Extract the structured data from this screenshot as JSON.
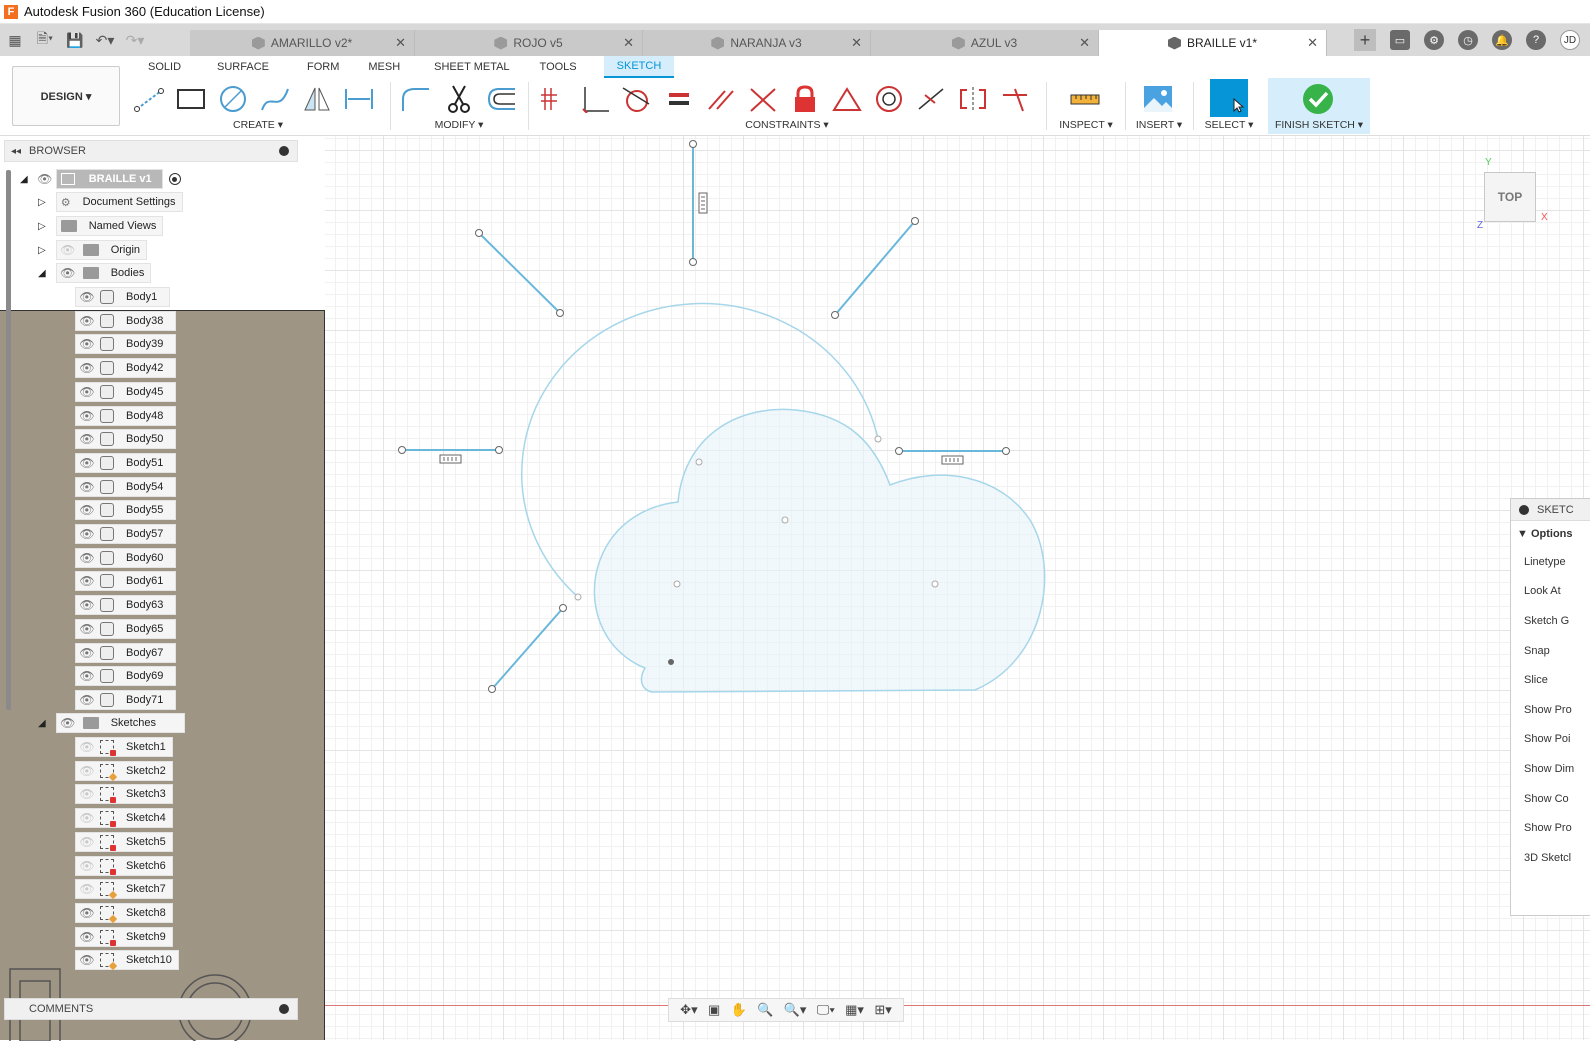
{
  "window": {
    "title": "Autodesk Fusion 360 (Education License)"
  },
  "tabs": [
    {
      "label": "AMARILLO v2*",
      "active": false
    },
    {
      "label": "ROJO v5",
      "active": false
    },
    {
      "label": "NARANJA v3",
      "active": false
    },
    {
      "label": "AZUL v3",
      "active": false
    },
    {
      "label": "BRAILLE v1*",
      "active": true
    }
  ],
  "user": {
    "initials": "JD"
  },
  "workspace": {
    "label": "DESIGN ▾"
  },
  "ribbon_tabs": [
    "SOLID",
    "SURFACE",
    "FORM",
    "MESH",
    "SHEET METAL",
    "TOOLS",
    "SKETCH"
  ],
  "groups": {
    "create": "CREATE ▾",
    "modify": "MODIFY ▾",
    "constraints": "CONSTRAINTS ▾",
    "inspect": "INSPECT ▾",
    "insert": "INSERT ▾",
    "select": "SELECT ▾",
    "finish": "FINISH SKETCH ▾"
  },
  "browser": {
    "title": "BROWSER",
    "root": "BRAILLE v1",
    "document_settings": "Document Settings",
    "named_views": "Named Views",
    "origin": "Origin",
    "bodies_folder": "Bodies",
    "bodies": [
      "Body1",
      "Body38",
      "Body39",
      "Body42",
      "Body45",
      "Body48",
      "Body50",
      "Body51",
      "Body54",
      "Body55",
      "Body57",
      "Body60",
      "Body61",
      "Body63",
      "Body65",
      "Body67",
      "Body69",
      "Body71"
    ],
    "sketches_folder": "Sketches",
    "sketches": [
      {
        "label": "Sketch1",
        "visible": false
      },
      {
        "label": "Sketch2",
        "visible": false
      },
      {
        "label": "Sketch3",
        "visible": false
      },
      {
        "label": "Sketch4",
        "visible": false
      },
      {
        "label": "Sketch5",
        "visible": false
      },
      {
        "label": "Sketch6",
        "visible": false
      },
      {
        "label": "Sketch7",
        "visible": false
      },
      {
        "label": "Sketch8",
        "visible": true
      },
      {
        "label": "Sketch9",
        "visible": true
      },
      {
        "label": "Sketch10",
        "visible": true
      }
    ]
  },
  "comments": {
    "title": "COMMENTS"
  },
  "viewcube": {
    "face": "TOP",
    "axis_x": "X",
    "axis_y": "Y",
    "axis_z": "Z"
  },
  "sketch_palette": {
    "title": "SKETC",
    "section": "Options",
    "items": [
      "Linetype",
      "Look At",
      "Sketch G",
      "Snap",
      "Slice",
      "Show Pro",
      "Show Poi",
      "Show Dim",
      "Show Co",
      "Show Pro",
      "3D Sketcl"
    ]
  },
  "colors": {
    "accent": "#0696d7",
    "sketch_line": "#69b8dc",
    "tan_bg": "#9e9584",
    "tab_bg": "#d9d9d9"
  }
}
